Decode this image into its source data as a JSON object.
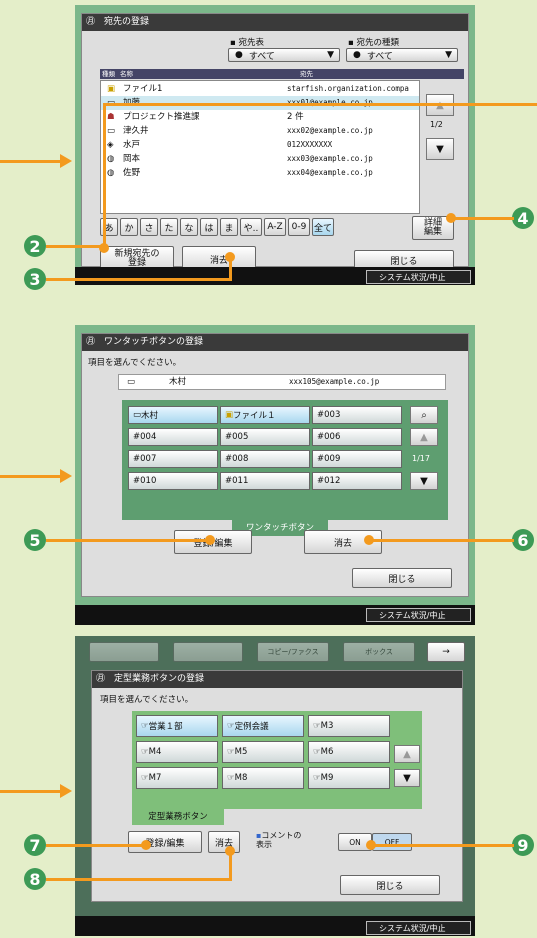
{
  "screen1": {
    "title": "宛先の登録",
    "addrbook_label": "宛先表",
    "addrbook_value": "すべて",
    "type_label": "宛先の種類",
    "type_value": "すべて",
    "col_type": "種類",
    "col_name": "名称",
    "col_addr": "宛先",
    "rows": [
      {
        "name": "ファイル1",
        "addr": "starfish.organization.compa"
      },
      {
        "name": "加藤",
        "addr": "xxx01@example.co.jp"
      },
      {
        "name": "プロジェクト推進課",
        "addr": "2 件"
      },
      {
        "name": "津久井",
        "addr": "xxx02@example.co.jp"
      },
      {
        "name": "水戸",
        "addr": "012XXXXXXX"
      },
      {
        "name": "岡本",
        "addr": "xxx03@example.co.jp"
      },
      {
        "name": "佐野",
        "addr": "xxx04@example.co.jp"
      }
    ],
    "page": "1/2",
    "kana": [
      "あ",
      "か",
      "さ",
      "た",
      "な",
      "は",
      "ま",
      "や..",
      "A-Z",
      "0-9",
      "全て"
    ],
    "detail_btn": "詳細\n編集",
    "new_btn": "新規宛先の\n登録",
    "delete_btn": "消去",
    "close_btn": "閉じる",
    "status_btn": "システム状況/中止"
  },
  "screen2": {
    "title": "ワンタッチボタンの登録",
    "prompt": "項目を選んでください。",
    "sel_name": "木村",
    "sel_addr": "xxx105@example.co.jp",
    "buttons": [
      "木村",
      "ファイル１",
      "#003",
      "#004",
      "#005",
      "#006",
      "#007",
      "#008",
      "#009",
      "#010",
      "#011",
      "#012"
    ],
    "page": "1/17",
    "tab": "ワンタッチボタン",
    "reg_btn": "登録/編集",
    "delete_btn": "消去",
    "close_btn": "閉じる",
    "status_btn": "システム状況/中止"
  },
  "screen3": {
    "title": "定型業務ボタンの登録",
    "prompt": "項目を選んでください。",
    "buttons": [
      "営業１部",
      "定例会議",
      "M3",
      "M4",
      "M5",
      "M6",
      "M7",
      "M8",
      "M9"
    ],
    "tab": "定型業務ボタン",
    "reg_btn": "登録/編集",
    "delete_btn": "消去",
    "comment_label": "コメントの\n表示",
    "on": "ON",
    "off": "OFF",
    "close_btn": "閉じる",
    "status_btn": "システム状況/中止",
    "top_tabs": [
      "コピー/ファクス",
      "ボックス"
    ]
  },
  "callouts": [
    "2",
    "3",
    "4",
    "5",
    "6",
    "7",
    "8",
    "9"
  ],
  "colors": {
    "accent_orange": "#f39a1e",
    "callout_green": "#3d9a56",
    "bg": "#e4eec9"
  }
}
